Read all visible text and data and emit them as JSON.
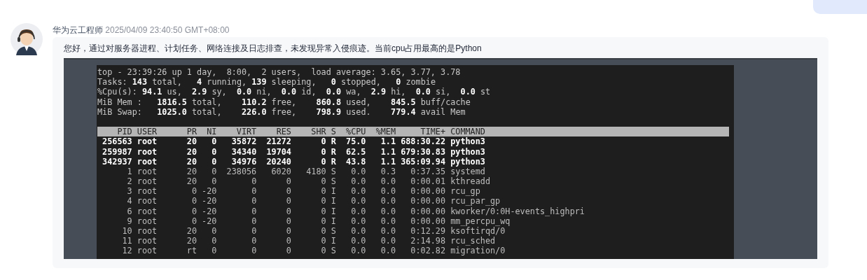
{
  "message": {
    "author": "华为云工程师",
    "timestamp": "2025/04/09 23:40:50 GMT+08:00",
    "text": "您好，通过对服务器进程、计划任务、网络连接及日志排查，未发现异常入侵痕迹。当前cpu占用最高的是Python"
  },
  "terminal": {
    "summary": [
      "top - 23:39:26 up 1 day,  8:00,  2 users,  load average: 3.65, 3.77, 3.78",
      "Tasks: **143** total,   **4** running, **139** sleeping,   **0** stopped,   **0** zombie",
      "%Cpu(s): **94.1** us,  **2.9** sy,  **0.0** ni,  **0.0** id,  **0.0** wa,  **2.9** hi,  **0.0** si,  **0.0** st",
      "MiB Mem :   **1816.5** total,    **110.2** free,    **860.8** used,    **845.5** buff/cache",
      "MiB Swap:   **1025.0** total,    **226.0** free,    **798.9** used.    **779.4** avail Mem"
    ],
    "columns": [
      "PID",
      "USER",
      "PR",
      "NI",
      "VIRT",
      "RES",
      "SHR",
      "S",
      "%CPU",
      "%MEM",
      "TIME+",
      "COMMAND"
    ],
    "rows": [
      {
        "highlighted": true,
        "cells": [
          "256563",
          "root",
          "20",
          "0",
          "35872",
          "21272",
          "0",
          "R",
          "75.0",
          "1.1",
          "688:30.22",
          "python3"
        ]
      },
      {
        "highlighted": true,
        "cells": [
          "259987",
          "root",
          "20",
          "0",
          "34340",
          "19704",
          "0",
          "R",
          "62.5",
          "1.1",
          "679:30.83",
          "python3"
        ]
      },
      {
        "highlighted": true,
        "cells": [
          "342937",
          "root",
          "20",
          "0",
          "34976",
          "20240",
          "0",
          "R",
          "43.8",
          "1.1",
          "365:09.94",
          "python3"
        ]
      },
      {
        "highlighted": false,
        "cells": [
          "1",
          "root",
          "20",
          "0",
          "238056",
          "6020",
          "4180",
          "S",
          "0.0",
          "0.3",
          "0:37.35",
          "systemd"
        ]
      },
      {
        "highlighted": false,
        "cells": [
          "2",
          "root",
          "20",
          "0",
          "0",
          "0",
          "0",
          "S",
          "0.0",
          "0.0",
          "0:00.01",
          "kthreadd"
        ]
      },
      {
        "highlighted": false,
        "cells": [
          "3",
          "root",
          "0",
          "-20",
          "0",
          "0",
          "0",
          "I",
          "0.0",
          "0.0",
          "0:00.00",
          "rcu_gp"
        ]
      },
      {
        "highlighted": false,
        "cells": [
          "4",
          "root",
          "0",
          "-20",
          "0",
          "0",
          "0",
          "I",
          "0.0",
          "0.0",
          "0:00.00",
          "rcu_par_gp"
        ]
      },
      {
        "highlighted": false,
        "cells": [
          "6",
          "root",
          "0",
          "-20",
          "0",
          "0",
          "0",
          "I",
          "0.0",
          "0.0",
          "0:00.00",
          "kworker/0:0H-events_highpri"
        ]
      },
      {
        "highlighted": false,
        "cells": [
          "9",
          "root",
          "0",
          "-20",
          "0",
          "0",
          "0",
          "I",
          "0.0",
          "0.0",
          "0:00.00",
          "mm_percpu_wq"
        ]
      },
      {
        "highlighted": false,
        "cells": [
          "10",
          "root",
          "20",
          "0",
          "0",
          "0",
          "0",
          "S",
          "0.0",
          "0.0",
          "0:12.29",
          "ksoftirqd/0"
        ]
      },
      {
        "highlighted": false,
        "cells": [
          "11",
          "root",
          "20",
          "0",
          "0",
          "0",
          "0",
          "I",
          "0.0",
          "0.0",
          "2:14.98",
          "rcu_sched"
        ]
      },
      {
        "highlighted": false,
        "cells": [
          "12",
          "root",
          "rt",
          "0",
          "0",
          "0",
          "0",
          "S",
          "0.0",
          "0.0",
          "0:02.82",
          "migration/0"
        ]
      }
    ]
  }
}
